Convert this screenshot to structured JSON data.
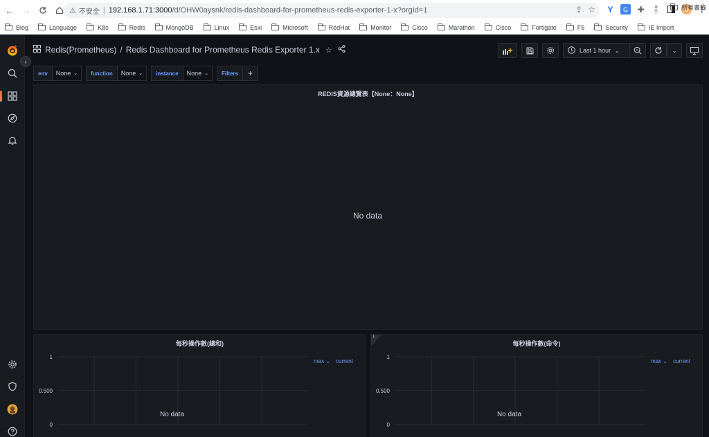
{
  "browser": {
    "warning_label": "不安全",
    "url_host": "192.168.1.71:3000",
    "url_path": "/d/OHW0aysnk/redis-dashboard-for-prometheus-redis-exporter-1-x?orgId=1",
    "bookmarks": [
      "Blog",
      "Language",
      "K8s",
      "Redis",
      "MongoDB",
      "Linux",
      "Esxi",
      "Microsoft",
      "RedHat",
      "Monitor",
      "Cisco",
      "Marathon",
      "Cisco",
      "Fortigate",
      "F5",
      "Security",
      "IE Import"
    ],
    "bookmarks_more": "»",
    "all_bookmarks": "所有書籤"
  },
  "navbar": {
    "folder": "Redis(Prometheus)",
    "separator": "/",
    "dashboard": "Redis Dashboard for Prometheus Redis Exporter 1.x",
    "time_range": "Last 1 hour"
  },
  "variables": [
    {
      "label": "env",
      "value": "None"
    },
    {
      "label": "function",
      "value": "None"
    },
    {
      "label": "instance",
      "value": "None"
    }
  ],
  "filters_label": "Filters",
  "add_filter": "+",
  "panels": {
    "overview": {
      "title": "REDIS資源總覽表【None：None】",
      "nodata": "No data"
    },
    "ops_total": {
      "title": "每秒操作數(總和)",
      "nodata": "No data",
      "yticks": [
        "1",
        "0.500",
        "0"
      ],
      "legend_max": "max",
      "legend_current": "current"
    },
    "ops_cmd": {
      "title": "每秒操作數(命令)",
      "nodata": "No data",
      "yticks": [
        "1",
        "0.500",
        "0"
      ],
      "legend_max": "max",
      "legend_current": "current",
      "info": "i"
    }
  },
  "chart_data": [
    {
      "type": "line",
      "title": "每秒操作數(總和)",
      "series": [],
      "ylim": [
        0,
        1
      ],
      "yticks": [
        0,
        0.5,
        1
      ],
      "grid": true
    },
    {
      "type": "line",
      "title": "每秒操作數(命令)",
      "series": [],
      "ylim": [
        0,
        1
      ],
      "yticks": [
        0,
        0.5,
        1
      ],
      "grid": true
    }
  ]
}
